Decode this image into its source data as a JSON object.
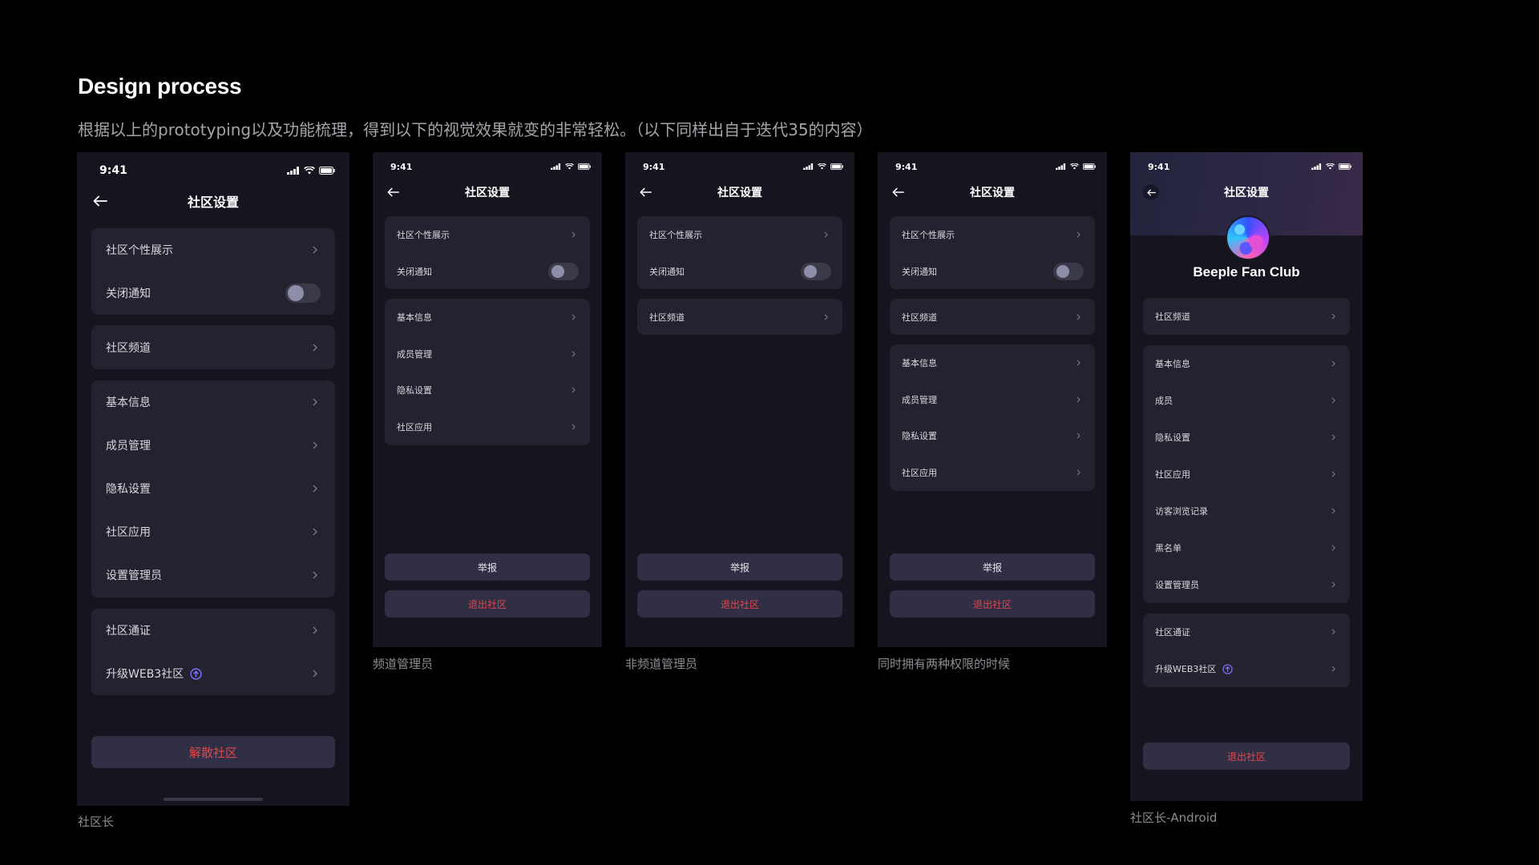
{
  "heading": "Design process",
  "subtitle": "根据以上的prototyping以及功能梳理，得到以下的视觉效果就变的非常轻松。（以下同样出自于迭代35的内容）",
  "captions": {
    "owner": "社区长",
    "channel_admin": "频道管理员",
    "non_channel_admin": "非频道管理员",
    "both": "同时拥有两种权限的时候",
    "owner_android": "社区长-Android"
  },
  "status_time": "9:41",
  "nav_title": "社区设置",
  "labels": {
    "profile_display": "社区个性展示",
    "mute_notice": "关闭通知",
    "channels": "社区频道",
    "basic_info": "基本信息",
    "member_mgmt": "成员管理",
    "members": "成员",
    "privacy": "隐私设置",
    "apps": "社区应用",
    "visitor_log": "访客浏览记录",
    "blacklist": "黑名单",
    "set_admin": "设置管理员",
    "token": "社区通证",
    "upgrade_web3": "升级WEB3社区",
    "report": "举报",
    "exit": "退出社区",
    "dissolve": "解散社区"
  },
  "club_name": "Beeple Fan Club",
  "colors": {
    "background": "#000000",
    "phone_bg": "#16141f",
    "card_bg": "#24222f",
    "button_bg": "#312f45",
    "danger": "#e0474c",
    "toggle_knob": "#8f8eaa",
    "web3_badge": "#7b74ff"
  },
  "toggle_on": false
}
